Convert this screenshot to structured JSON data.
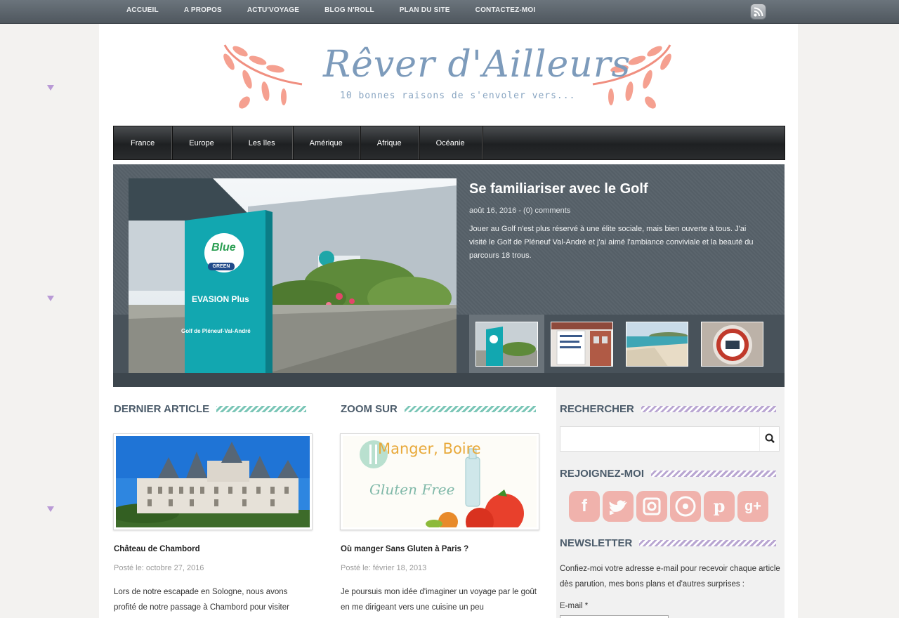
{
  "topnav": {
    "items": [
      "ACCUEIL",
      "A PROPOS",
      "ACTU'VOYAGE",
      "BLOG N'ROLL",
      "PLAN DU SITE",
      "CONTACTEZ-MOI"
    ]
  },
  "header": {
    "title": "Rêver d'Ailleurs",
    "subtitle": "10 bonnes raisons de s'envoler vers..."
  },
  "mainnav": {
    "items": [
      "France",
      "Europe",
      "Les îles",
      "Amérique",
      "Afrique",
      "Océanie"
    ]
  },
  "slider": {
    "title": "Se familiariser avec le Golf",
    "meta": "août 16, 2016 - (0) comments",
    "text": "Jouer au Golf n'est plus réservé à une élite sociale, mais bien ouverte à tous. J'ai visité le Golf de Pléneuf Val-André et j'ai aimé l'ambiance conviviale et la beauté du parcours 18 trous.",
    "sign_top": "Blue",
    "sign_green": "GREEN",
    "sign_brand": "EVASION Plus",
    "sign_place": "Golf de Pléneuf-Val-André"
  },
  "sections": {
    "latest": "DERNIER ARTICLE",
    "zoom": "ZOOM SUR",
    "search": "RECHERCHER",
    "join": "REJOIGNEZ-MOI",
    "newsletter": "NEWSLETTER"
  },
  "latest_post": {
    "title": "Château de Chambord",
    "date": "Posté le: octobre 27, 2016",
    "excerpt": "Lors de notre escapade en Sologne, nous avons profité de notre passage à Chambord pour visiter"
  },
  "zoom_post": {
    "title": "Où manger Sans Gluten à Paris ?",
    "date": "Posté le: février 18, 2013",
    "excerpt": "Je poursuis mon idée d'imaginer un voyage par le goût en me dirigeant vers une cuisine un peu",
    "image_line1": "Manger, Boire",
    "image_line2": "Gluten Free"
  },
  "newsletter": {
    "text": "Confiez-moi votre adresse e-mail pour recevoir chaque article dès parution, mes bons plans et d'autres surprises :",
    "email_label": "E-mail *"
  },
  "social_icons": [
    "facebook-icon",
    "twitter-icon",
    "instagram-icon",
    "flickr-icon",
    "pinterest-icon",
    "googleplus-icon"
  ],
  "colors": {
    "accent_teal": "#7bc6b7",
    "accent_lavender": "#b9a6d2",
    "title_blue": "#7d9bbb",
    "social_pink": "#f0a8a0"
  }
}
